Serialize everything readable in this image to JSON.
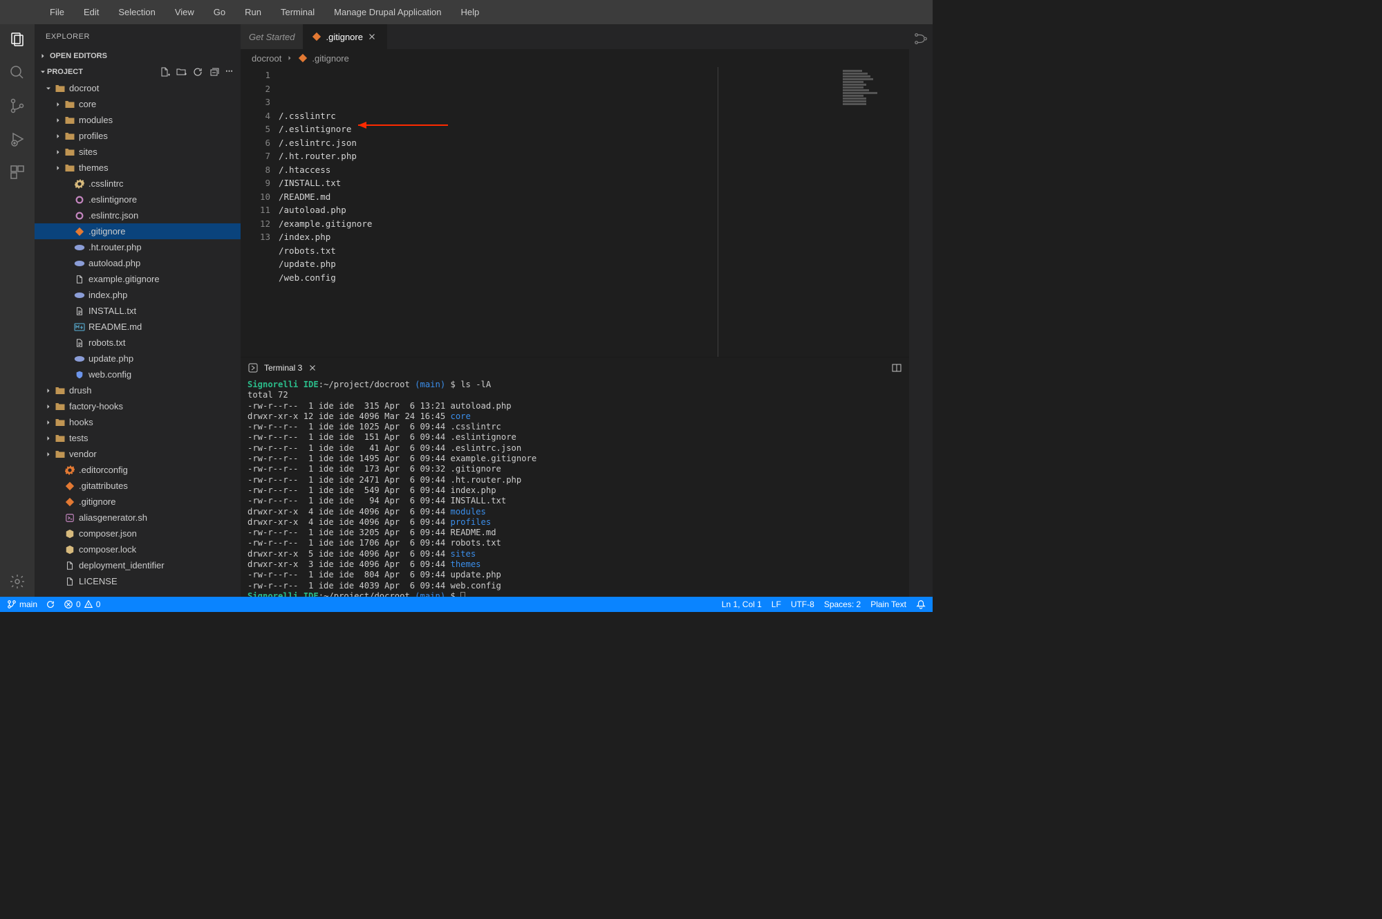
{
  "menubar": [
    "File",
    "Edit",
    "Selection",
    "View",
    "Go",
    "Run",
    "Terminal",
    "Manage Drupal Application",
    "Help"
  ],
  "sidebar": {
    "title": "EXPLORER",
    "open_editors_label": "OPEN EDITORS",
    "project_label": "PROJECT",
    "tree": [
      {
        "type": "folder",
        "name": "docroot",
        "depth": 0,
        "expanded": true
      },
      {
        "type": "folder",
        "name": "core",
        "depth": 1,
        "expanded": false
      },
      {
        "type": "folder",
        "name": "modules",
        "depth": 1,
        "expanded": false
      },
      {
        "type": "folder",
        "name": "profiles",
        "depth": 1,
        "expanded": false
      },
      {
        "type": "folder",
        "name": "sites",
        "depth": 1,
        "expanded": false
      },
      {
        "type": "folder",
        "name": "themes",
        "depth": 1,
        "expanded": false
      },
      {
        "type": "file",
        "name": ".csslintrc",
        "depth": 2,
        "icon": "gear",
        "color": "#d7ba7d"
      },
      {
        "type": "file",
        "name": ".eslintignore",
        "depth": 2,
        "icon": "circle",
        "color": "#c586c0"
      },
      {
        "type": "file",
        "name": ".eslintrc.json",
        "depth": 2,
        "icon": "circle",
        "color": "#c586c0"
      },
      {
        "type": "file",
        "name": ".gitignore",
        "depth": 2,
        "icon": "diamond",
        "color": "#e37933",
        "selected": true
      },
      {
        "type": "file",
        "name": ".ht.router.php",
        "depth": 2,
        "icon": "php",
        "color": "#8b9dd7"
      },
      {
        "type": "file",
        "name": "autoload.php",
        "depth": 2,
        "icon": "php",
        "color": "#8b9dd7"
      },
      {
        "type": "file",
        "name": "example.gitignore",
        "depth": 2,
        "icon": "doc",
        "color": "#c5c5c5"
      },
      {
        "type": "file",
        "name": "index.php",
        "depth": 2,
        "icon": "php",
        "color": "#8b9dd7"
      },
      {
        "type": "file",
        "name": "INSTALL.txt",
        "depth": 2,
        "icon": "txt",
        "color": "#c5c5c5"
      },
      {
        "type": "file",
        "name": "README.md",
        "depth": 2,
        "icon": "md",
        "color": "#519aba"
      },
      {
        "type": "file",
        "name": "robots.txt",
        "depth": 2,
        "icon": "txt",
        "color": "#c5c5c5"
      },
      {
        "type": "file",
        "name": "update.php",
        "depth": 2,
        "icon": "php",
        "color": "#8b9dd7"
      },
      {
        "type": "file",
        "name": "web.config",
        "depth": 2,
        "icon": "cfg",
        "color": "#6c95eb"
      },
      {
        "type": "folder",
        "name": "drush",
        "depth": 0,
        "expanded": false
      },
      {
        "type": "folder",
        "name": "factory-hooks",
        "depth": 0,
        "expanded": false
      },
      {
        "type": "folder",
        "name": "hooks",
        "depth": 0,
        "expanded": false
      },
      {
        "type": "folder",
        "name": "tests",
        "depth": 0,
        "expanded": false
      },
      {
        "type": "folder",
        "name": "vendor",
        "depth": 0,
        "expanded": false
      },
      {
        "type": "file",
        "name": ".editorconfig",
        "depth": 1,
        "icon": "gear-orange",
        "color": "#e37933"
      },
      {
        "type": "file",
        "name": ".gitattributes",
        "depth": 1,
        "icon": "diamond",
        "color": "#e37933"
      },
      {
        "type": "file",
        "name": ".gitignore",
        "depth": 1,
        "icon": "diamond",
        "color": "#e37933"
      },
      {
        "type": "file",
        "name": "aliasgenerator.sh",
        "depth": 1,
        "icon": "sh",
        "color": "#c586c0"
      },
      {
        "type": "file",
        "name": "composer.json",
        "depth": 1,
        "icon": "composer",
        "color": "#d7ba7d"
      },
      {
        "type": "file",
        "name": "composer.lock",
        "depth": 1,
        "icon": "composer",
        "color": "#d7ba7d"
      },
      {
        "type": "file",
        "name": "deployment_identifier",
        "depth": 1,
        "icon": "doc",
        "color": "#c5c5c5"
      },
      {
        "type": "file",
        "name": "LICENSE",
        "depth": 1,
        "icon": "doc",
        "color": "#c5c5c5"
      }
    ]
  },
  "tabs": [
    {
      "label": "Get Started",
      "active": false,
      "closable": false
    },
    {
      "label": ".gitignore",
      "active": true,
      "closable": true,
      "icon": "diamond"
    }
  ],
  "breadcrumbs": [
    {
      "label": "docroot"
    },
    {
      "label": ".gitignore",
      "icon": "diamond"
    }
  ],
  "editor_lines": [
    "/.csslintrc",
    "/.eslintignore",
    "/.eslintrc.json",
    "/.ht.router.php",
    "/.htaccess",
    "/INSTALL.txt",
    "/README.md",
    "/autoload.php",
    "/example.gitignore",
    "/index.php",
    "/robots.txt",
    "/update.php",
    "/web.config"
  ],
  "terminal": {
    "title": "Terminal 3",
    "prompt_prefix": "Signorelli IDE",
    "prompt_path": ":~/project/docroot",
    "prompt_branch": "(main)",
    "prompt_symbol": "$",
    "command": "ls -lA",
    "lines": [
      "total 72",
      "-rw-r--r--  1 ide ide  315 Apr  6 13:21 autoload.php",
      "drwxr-xr-x 12 ide ide 4096 Mar 24 16:45 core",
      "-rw-r--r--  1 ide ide 1025 Apr  6 09:44 .csslintrc",
      "-rw-r--r--  1 ide ide  151 Apr  6 09:44 .eslintignore",
      "-rw-r--r--  1 ide ide   41 Apr  6 09:44 .eslintrc.json",
      "-rw-r--r--  1 ide ide 1495 Apr  6 09:44 example.gitignore",
      "-rw-r--r--  1 ide ide  173 Apr  6 09:32 .gitignore",
      "-rw-r--r--  1 ide ide 2471 Apr  6 09:44 .ht.router.php",
      "-rw-r--r--  1 ide ide  549 Apr  6 09:44 index.php",
      "-rw-r--r--  1 ide ide   94 Apr  6 09:44 INSTALL.txt",
      "drwxr-xr-x  4 ide ide 4096 Apr  6 09:44 modules",
      "drwxr-xr-x  4 ide ide 4096 Apr  6 09:44 profiles",
      "-rw-r--r--  1 ide ide 3205 Apr  6 09:44 README.md",
      "-rw-r--r--  1 ide ide 1706 Apr  6 09:44 robots.txt",
      "drwxr-xr-x  5 ide ide 4096 Apr  6 09:44 sites",
      "drwxr-xr-x  3 ide ide 4096 Apr  6 09:44 themes",
      "-rw-r--r--  1 ide ide  804 Apr  6 09:44 update.php",
      "-rw-r--r--  1 ide ide 4039 Apr  6 09:44 web.config"
    ],
    "dir_entries": [
      "core",
      "modules",
      "profiles",
      "sites",
      "themes"
    ]
  },
  "statusbar": {
    "branch": "main",
    "errors": "0",
    "warnings": "0",
    "position": "Ln 1, Col 1",
    "eol": "LF",
    "encoding": "UTF-8",
    "indent": "Spaces: 2",
    "lang": "Plain Text"
  }
}
